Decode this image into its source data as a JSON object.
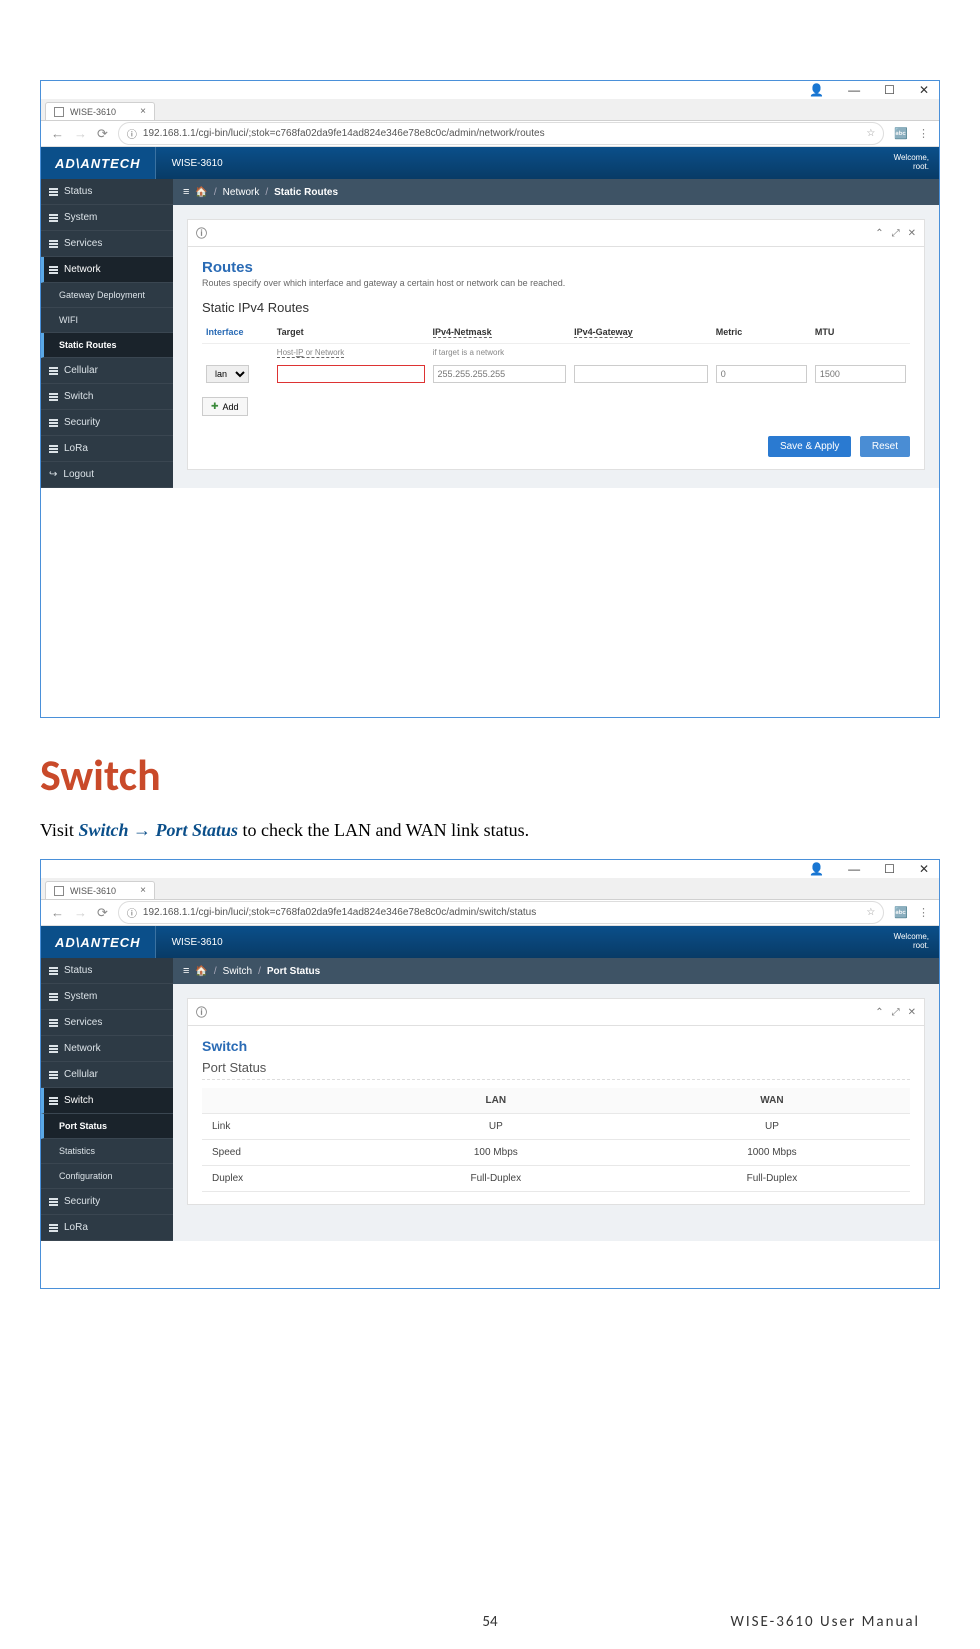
{
  "browser1": {
    "tab_title": "WISE-3610",
    "url": "192.168.1.1/cgi-bin/luci/;stok=c768fa02da9fe14ad824e346e78e8c0c/admin/network/routes",
    "welcome_line1": "Welcome,",
    "welcome_line2": "root.",
    "logo": "AD\\ANTECH",
    "device": "WISE-3610",
    "sidebar": [
      "Status",
      "System",
      "Services",
      "Network",
      "Gateway Deployment",
      "WIFI",
      "Static Routes",
      "Cellular",
      "Switch",
      "Security",
      "LoRa",
      "Logout"
    ],
    "crumb_net": "Network",
    "crumb_page": "Static Routes",
    "panel_title": "Routes",
    "panel_desc": "Routes specify over which interface and gateway a certain host or network can be reached.",
    "section_head": "Static IPv4 Routes",
    "cols": {
      "iface": "Interface",
      "target": "Target",
      "mask": "IPv4-Netmask",
      "gw": "IPv4-Gateway",
      "metric": "Metric",
      "mtu": "MTU"
    },
    "hints": {
      "target": "Host-IP or Network",
      "mask": "if target is a network"
    },
    "row": {
      "iface": "lan",
      "mask_ph": "255.255.255.255",
      "metric_ph": "0",
      "mtu_ph": "1500"
    },
    "add_btn": "Add",
    "save_btn": "Save & Apply",
    "reset_btn": "Reset"
  },
  "doc": {
    "h1": "Switch",
    "p_pre": "Visit ",
    "p_nav1": "Switch",
    "p_arrow": " → ",
    "p_nav2": "Port Status",
    "p_post": " to check the LAN and WAN link status."
  },
  "browser2": {
    "tab_title": "WISE-3610",
    "url": "192.168.1.1/cgi-bin/luci/;stok=c768fa02da9fe14ad824e346e78e8c0c/admin/switch/status",
    "welcome_line1": "Welcome,",
    "welcome_line2": "root.",
    "logo": "AD\\ANTECH",
    "device": "WISE-3610",
    "sidebar": [
      "Status",
      "System",
      "Services",
      "Network",
      "Cellular",
      "Switch",
      "Port Status",
      "Statistics",
      "Configuration",
      "Security",
      "LoRa"
    ],
    "crumb_sw": "Switch",
    "crumb_page": "Port Status",
    "panel_title": "Switch",
    "section_head": "Port Status",
    "cols": {
      "lan": "LAN",
      "wan": "WAN"
    },
    "rows": {
      "link": {
        "label": "Link",
        "lan": "UP",
        "wan": "UP"
      },
      "speed": {
        "label": "Speed",
        "lan": "100 Mbps",
        "wan": "1000 Mbps"
      },
      "duplex": {
        "label": "Duplex",
        "lan": "Full-Duplex",
        "wan": "Full-Duplex"
      }
    }
  },
  "footer": {
    "page": "54",
    "title": "WISE-3610  User  Manual"
  }
}
